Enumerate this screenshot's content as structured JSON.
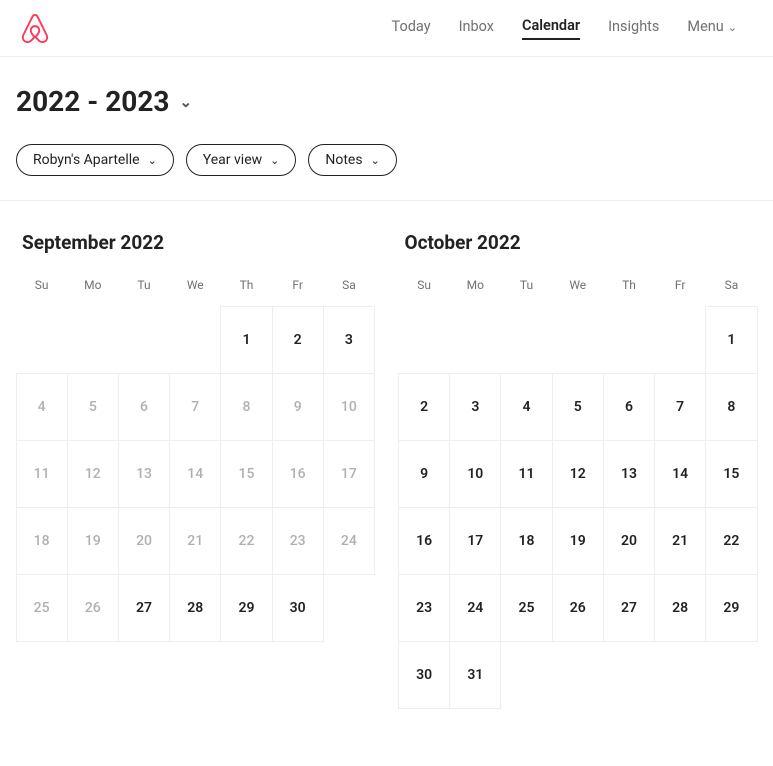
{
  "nav": {
    "items": [
      {
        "label": "Today",
        "active": false
      },
      {
        "label": "Inbox",
        "active": false
      },
      {
        "label": "Calendar",
        "active": true
      },
      {
        "label": "Insights",
        "active": false
      },
      {
        "label": "Menu",
        "active": false,
        "chevron": true
      }
    ]
  },
  "header": {
    "year_range": "2022 - 2023"
  },
  "filters": {
    "listing": "Robyn's Apartelle",
    "view": "Year view",
    "notes": "Notes"
  },
  "dow_labels": [
    "Su",
    "Mo",
    "Tu",
    "We",
    "Th",
    "Fr",
    "Sa"
  ],
  "months": [
    {
      "title": "September 2022",
      "leading_blanks": 4,
      "days": [
        {
          "n": 1,
          "past": false
        },
        {
          "n": 2,
          "past": false
        },
        {
          "n": 3,
          "past": false
        },
        {
          "n": 4,
          "past": true
        },
        {
          "n": 5,
          "past": true
        },
        {
          "n": 6,
          "past": true
        },
        {
          "n": 7,
          "past": true
        },
        {
          "n": 8,
          "past": true
        },
        {
          "n": 9,
          "past": true
        },
        {
          "n": 10,
          "past": true
        },
        {
          "n": 11,
          "past": true
        },
        {
          "n": 12,
          "past": true
        },
        {
          "n": 13,
          "past": true
        },
        {
          "n": 14,
          "past": true
        },
        {
          "n": 15,
          "past": true
        },
        {
          "n": 16,
          "past": true
        },
        {
          "n": 17,
          "past": true
        },
        {
          "n": 18,
          "past": true
        },
        {
          "n": 19,
          "past": true
        },
        {
          "n": 20,
          "past": true
        },
        {
          "n": 21,
          "past": true
        },
        {
          "n": 22,
          "past": true
        },
        {
          "n": 23,
          "past": true
        },
        {
          "n": 24,
          "past": true
        },
        {
          "n": 25,
          "past": true
        },
        {
          "n": 26,
          "past": true
        },
        {
          "n": 27,
          "past": false
        },
        {
          "n": 28,
          "past": false
        },
        {
          "n": 29,
          "past": false
        },
        {
          "n": 30,
          "past": false
        }
      ]
    },
    {
      "title": "October 2022",
      "leading_blanks": 6,
      "days": [
        {
          "n": 1,
          "past": false
        },
        {
          "n": 2,
          "past": false
        },
        {
          "n": 3,
          "past": false
        },
        {
          "n": 4,
          "past": false
        },
        {
          "n": 5,
          "past": false
        },
        {
          "n": 6,
          "past": false
        },
        {
          "n": 7,
          "past": false
        },
        {
          "n": 8,
          "past": false
        },
        {
          "n": 9,
          "past": false
        },
        {
          "n": 10,
          "past": false
        },
        {
          "n": 11,
          "past": false
        },
        {
          "n": 12,
          "past": false
        },
        {
          "n": 13,
          "past": false
        },
        {
          "n": 14,
          "past": false
        },
        {
          "n": 15,
          "past": false
        },
        {
          "n": 16,
          "past": false
        },
        {
          "n": 17,
          "past": false
        },
        {
          "n": 18,
          "past": false
        },
        {
          "n": 19,
          "past": false
        },
        {
          "n": 20,
          "past": false
        },
        {
          "n": 21,
          "past": false
        },
        {
          "n": 22,
          "past": false
        },
        {
          "n": 23,
          "past": false
        },
        {
          "n": 24,
          "past": false
        },
        {
          "n": 25,
          "past": false
        },
        {
          "n": 26,
          "past": false
        },
        {
          "n": 27,
          "past": false
        },
        {
          "n": 28,
          "past": false
        },
        {
          "n": 29,
          "past": false
        },
        {
          "n": 30,
          "past": false
        },
        {
          "n": 31,
          "past": false
        }
      ]
    }
  ]
}
